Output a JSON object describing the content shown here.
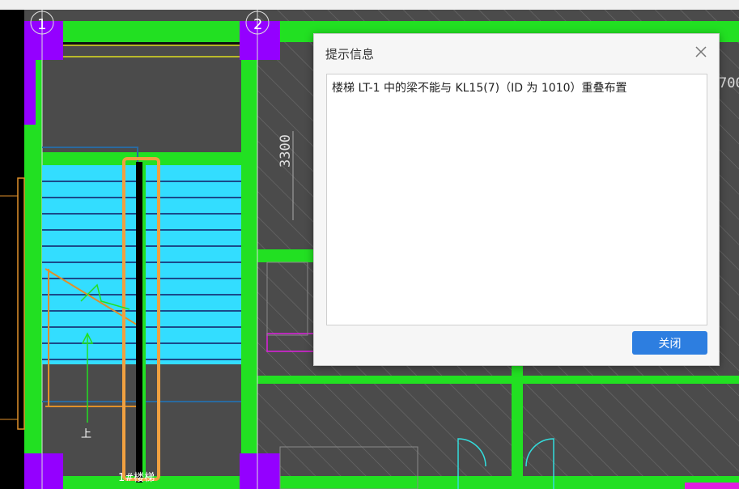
{
  "drawing": {
    "axis_labels": [
      "1",
      "2"
    ],
    "dimension_label": "3300",
    "dimension_label_partial": "700",
    "stair_up_mark": "上",
    "stair_tag": "1#楼梯",
    "colors": {
      "background": "#4a4a4a",
      "beam": "#22e022",
      "column": "#9400ff",
      "stair_fill": "#33ddff",
      "highlight": "#f0a040",
      "hatch": "#7a7a7a"
    }
  },
  "dialog": {
    "title": "提示信息",
    "message": "楼梯 LT-1 中的梁不能与 KL15(7)（ID 为 1010）重叠布置",
    "close_button_label": "关闭",
    "close_icon": "close-icon"
  }
}
